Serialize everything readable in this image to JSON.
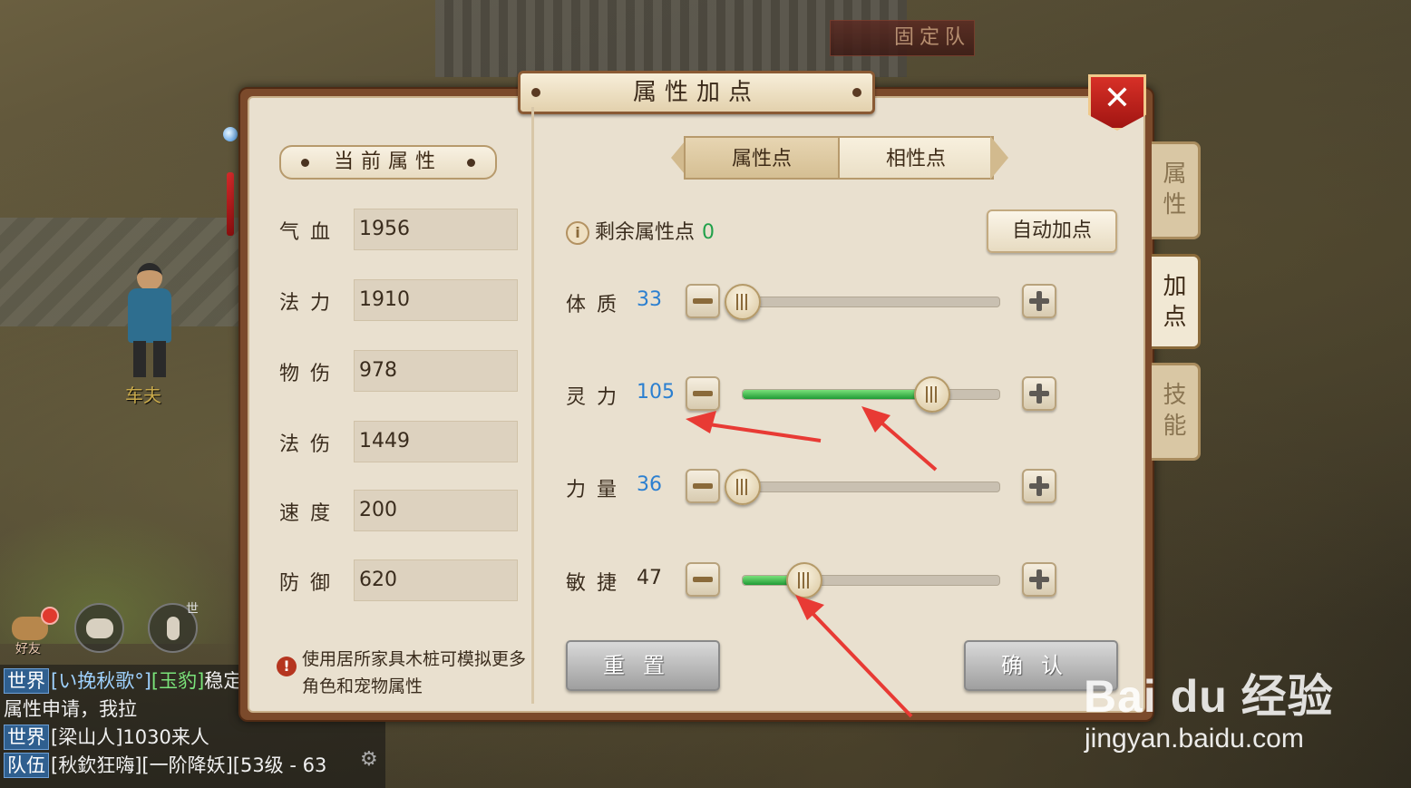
{
  "scene": {
    "npc_name": "车夫",
    "fixed_team_label": "固定队"
  },
  "panel": {
    "title": "属性加点",
    "close_label": "✕",
    "side_tabs": [
      "属\n性",
      "加\n点",
      "技\n能"
    ],
    "active_side_tab": "加点"
  },
  "left": {
    "section_title": "当前属性",
    "stats": [
      {
        "label": "气血",
        "value": "1956"
      },
      {
        "label": "法力",
        "value": "1910"
      },
      {
        "label": "物伤",
        "value": "978"
      },
      {
        "label": "法伤",
        "value": "1449"
      },
      {
        "label": "速度",
        "value": "200"
      },
      {
        "label": "防御",
        "value": "620"
      }
    ],
    "note": "使用居所家具木桩可模拟更多角色和宠物属性"
  },
  "right": {
    "tabs": [
      {
        "label": "属性点",
        "active": true
      },
      {
        "label": "相性点",
        "active": false
      }
    ],
    "remaining_label": "剩余属性点",
    "remaining_value": "0",
    "auto_button": "自动加点",
    "attributes": [
      {
        "label": "体质",
        "value": "33",
        "value_color": "#2b7fd0",
        "slider_fraction": 0.0
      },
      {
        "label": "灵力",
        "value": "105",
        "value_color": "#2b7fd0",
        "slider_fraction": 0.74
      },
      {
        "label": "力量",
        "value": "36",
        "value_color": "#2b7fd0",
        "slider_fraction": 0.0
      },
      {
        "label": "敏捷",
        "value": "47",
        "value_color": "#3a2c1d",
        "slider_fraction": 0.24
      }
    ],
    "reset_button": "重置",
    "confirm_button": "确认"
  },
  "social": {
    "friend_label": "好友",
    "voice_sup": "世"
  },
  "chat": [
    {
      "channel": "世界",
      "parts": [
        {
          "t": "[い挽秋歌°]",
          "c": "who"
        },
        {
          "t": "[玉豹]",
          "c": "hl"
        },
        {
          "t": "稳定",
          "c": ""
        }
      ]
    },
    {
      "channel": "",
      "parts": [
        {
          "t": "属性申请，我拉",
          "c": ""
        }
      ]
    },
    {
      "channel": "世界",
      "parts": [
        {
          "t": "[梁山人]1030来人",
          "c": ""
        }
      ]
    },
    {
      "channel": "队伍",
      "parts": [
        {
          "t": "[秋欽狂嗨][一阶降妖][53级 - 63",
          "c": ""
        }
      ]
    }
  ],
  "watermark": {
    "logo": "Bai du 经验",
    "url": "jingyan.baidu.com"
  },
  "colors": {
    "accent_green": "#21a14a",
    "value_blue": "#2b7fd0",
    "close_red": "#d73027",
    "panel_bg": "#e9e0cf"
  }
}
